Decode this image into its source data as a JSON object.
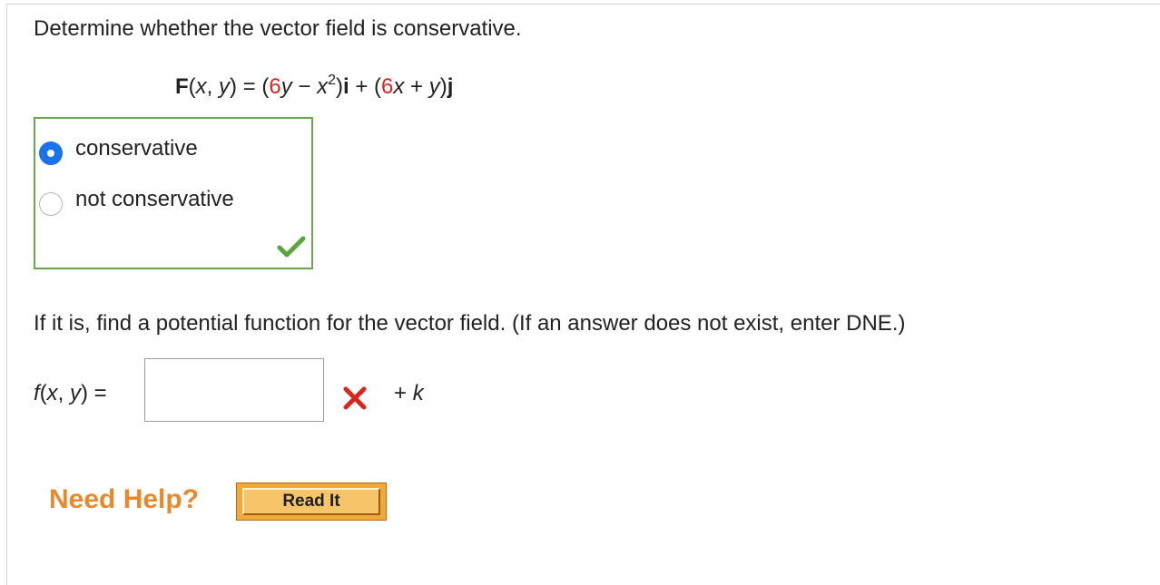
{
  "question": {
    "text": "Determine whether the vector field is conservative."
  },
  "equation": {
    "F": "F",
    "paren_open": "(",
    "x": "x",
    "comma": ", ",
    "y": "y",
    "paren_close_eq": ") = (",
    "coef1": "6",
    "y2": "y",
    "minus": " − ",
    "x2": "x",
    "exp": "2",
    "close_i": ")",
    "i": "i",
    "plus": " + (",
    "coef2": "6",
    "x3": "x",
    "plus_y": " + ",
    "y3": "y",
    "close_j": ")",
    "j": "j"
  },
  "choices": {
    "options": [
      {
        "label": "conservative",
        "selected": true
      },
      {
        "label": "not conservative",
        "selected": false
      }
    ],
    "result": "correct",
    "accent_color": "#6aa84f"
  },
  "prompt": {
    "text": "If it is, find a potential function for the vector field. (If an answer does not exist, enter DNE.)"
  },
  "answer": {
    "f": "f",
    "vars_open": "(",
    "x": "x",
    "comma": ", ",
    "y": "y",
    "vars_close": ") =",
    "value": "",
    "result": "incorrect",
    "plus": "+ ",
    "k": "k"
  },
  "help": {
    "label": "Need Help?",
    "read_it_label": "Read It",
    "color": "#e8892b"
  },
  "icons": {
    "correct": "checkmark-icon",
    "incorrect": "x-mark-icon",
    "radio": "radio-button"
  }
}
